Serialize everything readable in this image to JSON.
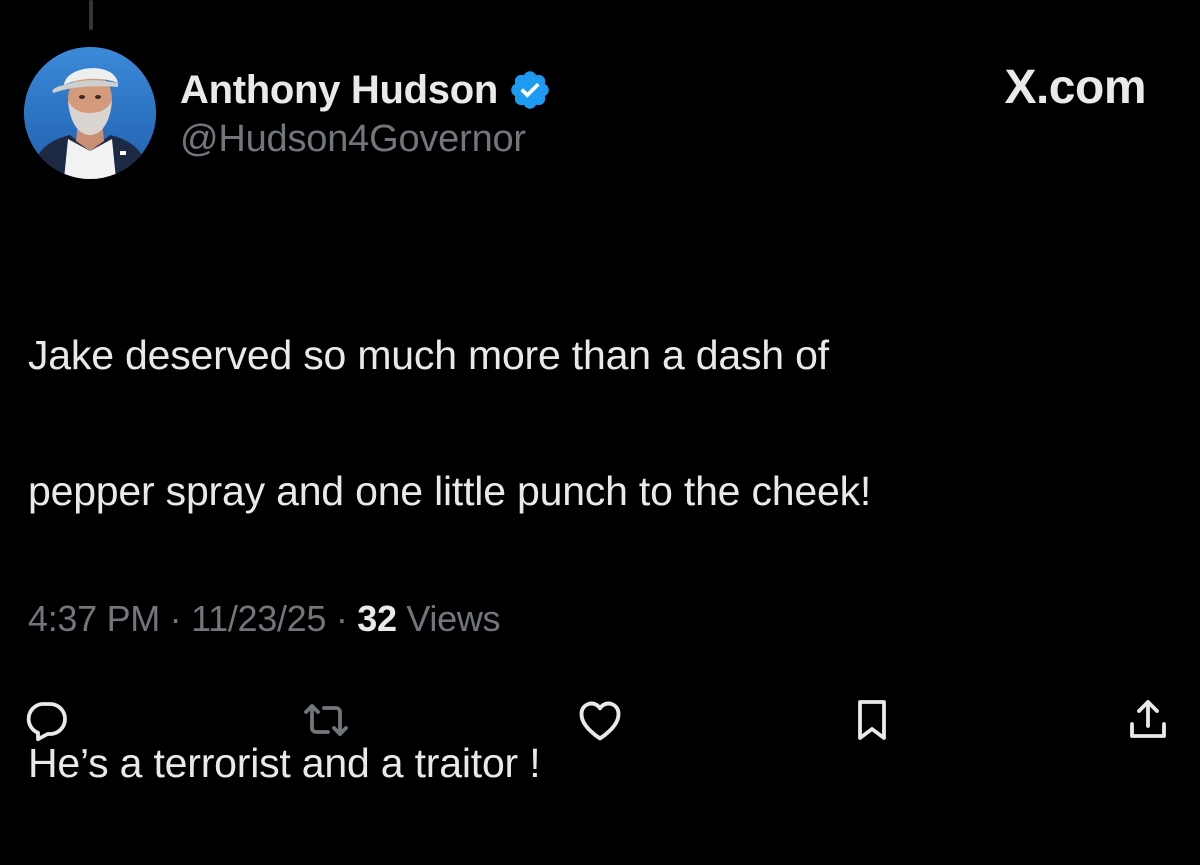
{
  "tweet": {
    "author": {
      "display_name": "Anthony Hudson",
      "handle": "@Hudson4Governor",
      "verified": true,
      "avatar_icon": "profile-photo"
    },
    "brand": "X.com",
    "text_lines": [
      "Jake deserved so much more than a dash of",
      "pepper spray and one little punch to the cheek!",
      "He’s a terrorist and a traitor !"
    ],
    "meta": {
      "time": "4:37 PM",
      "separator": " · ",
      "date": "11/23/25",
      "views_count": "32",
      "views_label": " Views"
    },
    "actions": [
      {
        "name": "reply",
        "icon": "reply-icon"
      },
      {
        "name": "retweet",
        "icon": "retweet-icon"
      },
      {
        "name": "like",
        "icon": "heart-icon"
      },
      {
        "name": "bookmark",
        "icon": "bookmark-icon"
      },
      {
        "name": "share",
        "icon": "share-icon"
      }
    ]
  },
  "colors": {
    "background": "#000000",
    "primary_text": "#e7e9ea",
    "secondary_text": "#71767b",
    "verified_blue": "#1d9bf0",
    "action_icon": "#71767b"
  }
}
